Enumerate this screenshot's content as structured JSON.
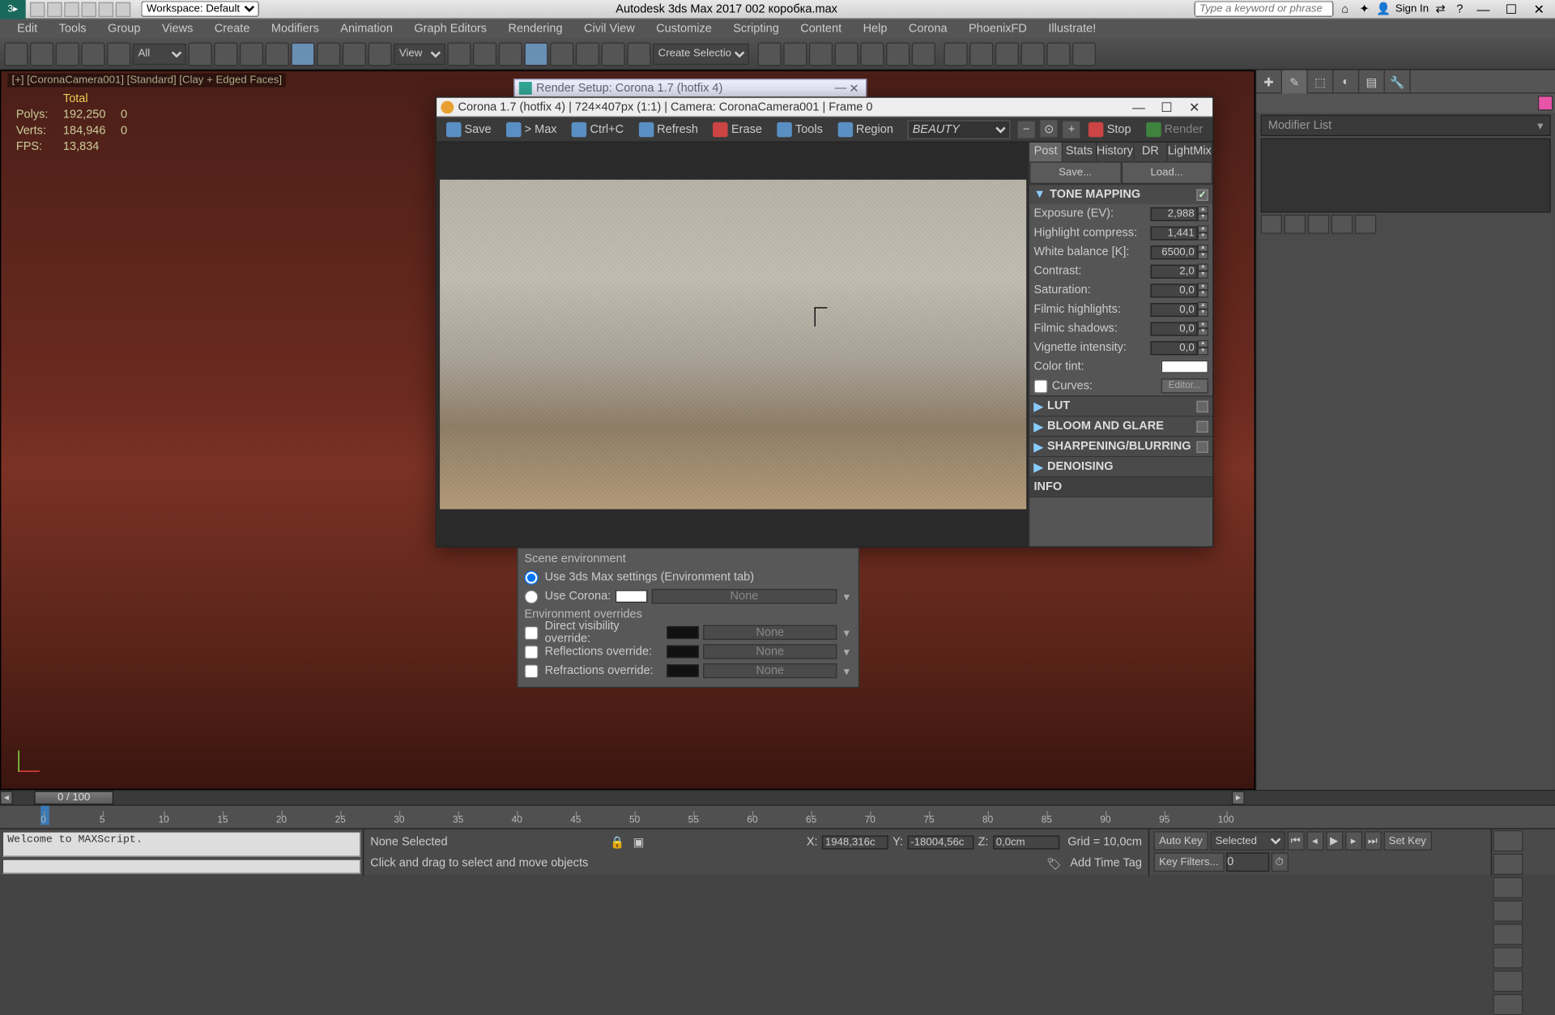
{
  "app": {
    "title": "Autodesk 3ds Max 2017   002 коробка.max",
    "workspace_label": "Workspace: Default",
    "search_placeholder": "Type a keyword or phrase",
    "signin": "Sign In"
  },
  "menu": [
    "Edit",
    "Tools",
    "Group",
    "Views",
    "Create",
    "Modifiers",
    "Animation",
    "Graph Editors",
    "Rendering",
    "Civil View",
    "Customize",
    "Scripting",
    "Content",
    "Help",
    "Corona",
    "PhoenixFD",
    "Illustrate!"
  ],
  "toolbar": {
    "all": "All",
    "view": "View",
    "selset": "Create Selection Se"
  },
  "viewport": {
    "label": "[+] [CoronaCamera001] [Standard] [Clay + Edged Faces]",
    "stats": {
      "total_h": "Total",
      "polys_l": "Polys:",
      "polys_v": "192,250",
      "polys_s": "0",
      "verts_l": "Verts:",
      "verts_v": "184,946",
      "verts_s": "0",
      "fps_l": "FPS:",
      "fps_v": "13,834"
    }
  },
  "cmd": {
    "modifier_list": "Modifier List"
  },
  "rendersetup": {
    "title": "Render Setup: Corona 1.7 (hotfix 4)"
  },
  "vfb": {
    "title": "Corona 1.7 (hotfix 4) | 724×407px (1:1) | Camera: CoronaCamera001 | Frame 0",
    "buttons": {
      "save": "Save",
      "max": "> Max",
      "ctrlc": "Ctrl+C",
      "refresh": "Refresh",
      "erase": "Erase",
      "tools": "Tools",
      "region": "Region",
      "beauty": "BEAUTY",
      "stop": "Stop",
      "render": "Render"
    },
    "tabs": [
      "Post",
      "Stats",
      "History",
      "DR",
      "LightMix"
    ],
    "save_btn": "Save...",
    "load_btn": "Load...",
    "tone": {
      "title": "TONE MAPPING",
      "params": [
        {
          "l": "Exposure (EV):",
          "v": "2,988"
        },
        {
          "l": "Highlight compress:",
          "v": "1,441"
        },
        {
          "l": "White balance [K]:",
          "v": "6500,0"
        },
        {
          "l": "Contrast:",
          "v": "2,0"
        },
        {
          "l": "Saturation:",
          "v": "0,0"
        },
        {
          "l": "Filmic highlights:",
          "v": "0,0"
        },
        {
          "l": "Filmic shadows:",
          "v": "0,0"
        },
        {
          "l": "Vignette intensity:",
          "v": "0,0"
        }
      ],
      "colortint": "Color tint:",
      "curves": "Curves:",
      "curves_btn": "Editor..."
    },
    "sections": [
      "LUT",
      "BLOOM AND GLARE",
      "SHARPENING/BLURRING",
      "DENOISING",
      "INFO"
    ]
  },
  "env": {
    "title": "Scene environment",
    "use_max": "Use 3ds Max settings (Environment tab)",
    "use_corona": "Use Corona:",
    "overrides_title": "Environment overrides",
    "rows": [
      {
        "l": "Direct visibility override:",
        "sw": "#111",
        "map": "None"
      },
      {
        "l": "Reflections override:",
        "sw": "#111",
        "map": "None"
      },
      {
        "l": "Refractions override:",
        "sw": "#111",
        "map": "None"
      }
    ],
    "corona_sw": "#fff",
    "corona_map": "None"
  },
  "timeline": {
    "slider": "0 / 100",
    "ticks": [
      0,
      5,
      10,
      15,
      20,
      25,
      30,
      35,
      40,
      45,
      50,
      55,
      60,
      65,
      70,
      75,
      80,
      85,
      90,
      95,
      100
    ]
  },
  "status": {
    "script_out": "Welcome to MAXScript.",
    "sel": "None Selected",
    "hint": "Click and drag to select and move objects",
    "x_l": "X:",
    "x_v": "1948,316c",
    "y_l": "Y:",
    "y_v": "-18004,56c",
    "z_l": "Z:",
    "z_v": "0,0cm",
    "grid": "Grid = 10,0cm",
    "addtag": "Add Time Tag",
    "autokey": "Auto Key",
    "setkey": "Set Key",
    "selected": "Selected",
    "keyfilters": "Key Filters..."
  }
}
